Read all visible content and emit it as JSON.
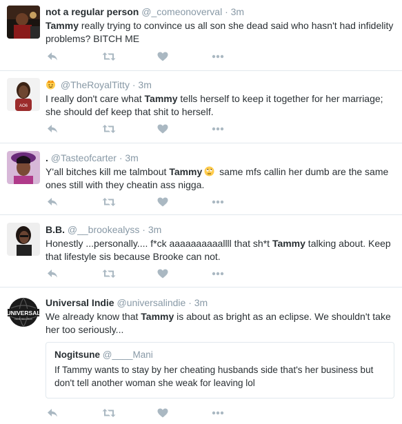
{
  "tweets": [
    {
      "name": "not a regular person",
      "handle": "@_comeonoverval",
      "time": "3m",
      "text_bold": "Tammy",
      "text_rest": " really trying to convince us all son she dead said who hasn't had infidelity problems? BITCH ME"
    },
    {
      "name": "",
      "handle": "@TheRoyalTitty",
      "time": "3m",
      "text_pre": "I really don't care what ",
      "text_bold": "Tammy",
      "text_rest": " tells herself to keep it together for her marriage; she should def keep that shit to herself."
    },
    {
      "name": ".",
      "handle": "@Tasteofcarter",
      "time": "3m",
      "text_pre": "Y'all bitches kill me talmbout ",
      "text_bold": "Tammy",
      "text_rest": " same mfs callin her dumb are the same ones still with they cheatin ass nigga."
    },
    {
      "name": "B.B.",
      "handle": "@__brookealyss",
      "time": "3m",
      "text_pre": "Honestly ...personally.... f*ck aaaaaaaaaallll that sh*t ",
      "text_bold": "Tammy",
      "text_rest": " talking about. Keep that lifestyle sis because Brooke can not."
    },
    {
      "name": "Universal Indie",
      "handle": "@universalindie",
      "time": "3m",
      "text_pre": "We already know that ",
      "text_bold": "Tammy",
      "text_rest": " is about as bright as an eclipse. We shouldn't take her too seriously...",
      "logo_text": "UNIVERSAL",
      "logo_sub": "INDIE RECORDS",
      "quote": {
        "name": "Nogitsune",
        "handle": "@____Mani",
        "text": "If Tammy wants to stay by her cheating husbands side that's her business but don't tell another woman she weak for leaving lol"
      }
    }
  ],
  "separator": "·",
  "icons": {
    "reply": "reply-icon",
    "retweet": "retweet-icon",
    "like": "heart-icon",
    "more": "more-icon",
    "emoji_name": "crown-emoji-icon",
    "emoji_inline": "eye-roll-emoji-icon"
  },
  "colors": {
    "text": "#292f33",
    "muted": "#8899a6",
    "action": "#aab8c2",
    "border": "#e1e8ed",
    "emoji": "#ffcc4d"
  }
}
